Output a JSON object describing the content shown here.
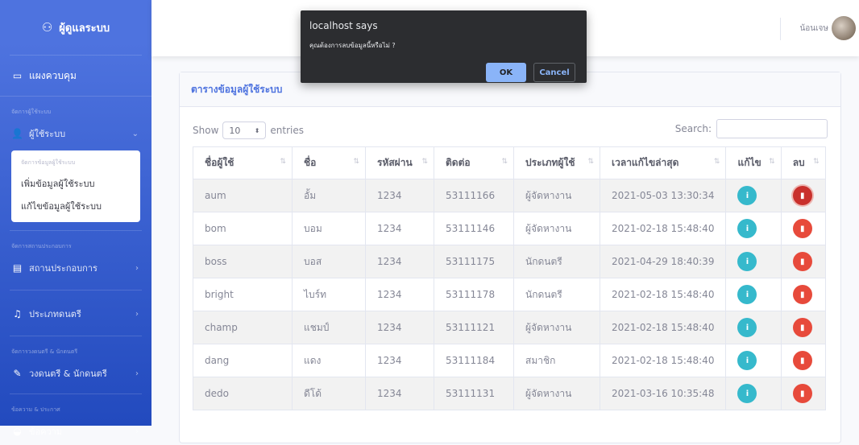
{
  "sidebar": {
    "brand": "ผู้ดูแลระบบ",
    "dashboard": "แผงควบคุม",
    "section_users": "จัดการผู้ใช้ระบบ",
    "users_item": "ผู้ใช้ระบบ",
    "submenu": {
      "header": "จัดการข้อมูลผู้ใช้ระบบ",
      "add": "เพิ่มข้อมูลผู้ใช้ระบบ",
      "edit": "แก้ไขข้อมูลผู้ใช้ระบบ"
    },
    "section_venues": "จัดการสถานประกอบการ",
    "venues_item": "สถานประกอบการ",
    "music_type_item": "ประเภทดนตรี",
    "section_bands": "จัดการวงดนตรี & นักดนตรี",
    "bands_item": "วงดนตรี & นักดนตรี",
    "section_messages": "ข้อความ & ประกาศ",
    "messages_item": "ข้อความ"
  },
  "topbar": {
    "username": "น้อนเจษ"
  },
  "card": {
    "title": "ตารางข้อมูลผู้ใช้ระบบ"
  },
  "controls": {
    "show_label": "Show",
    "entries_value": "10",
    "entries_label": "entries",
    "search_label": "Search:"
  },
  "table": {
    "headers": [
      "ชื่อผู้ใช้",
      "ชื่อ",
      "รหัสผ่าน",
      "ติดต่อ",
      "ประเภทผู้ใช้",
      "เวลาแก้ไขล่าสุด",
      "แก้ไข",
      "ลบ"
    ],
    "rows": [
      [
        "aum",
        "อั้ม",
        "1234",
        "53111166",
        "ผู้จัดหางาน",
        "2021-05-03 13:30:34"
      ],
      [
        "bom",
        "บอม",
        "1234",
        "53111146",
        "ผู้จัดหางาน",
        "2021-02-18 15:48:40"
      ],
      [
        "boss",
        "บอส",
        "1234",
        "53111175",
        "นักดนตรี",
        "2021-04-29 18:40:39"
      ],
      [
        "bright",
        "ไบร์ท",
        "1234",
        "53111178",
        "นักดนตรี",
        "2021-02-18 15:48:40"
      ],
      [
        "champ",
        "แชมป์",
        "1234",
        "53111121",
        "ผู้จัดหางาน",
        "2021-02-18 15:48:40"
      ],
      [
        "dang",
        "แดง",
        "1234",
        "53111184",
        "สมาชิก",
        "2021-02-18 15:48:40"
      ],
      [
        "dedo",
        "ดีโด้",
        "1234",
        "53111131",
        "ผู้จัดหางาน",
        "2021-03-16 10:35:48"
      ]
    ]
  },
  "dialog": {
    "title": "localhost says",
    "message": "คุณต้องการลบข้อมูลนี้หรือไม่ ?",
    "ok": "OK",
    "cancel": "Cancel"
  },
  "colors": {
    "primary": "#4e73df",
    "info": "#36b9cc",
    "danger": "#e74a3b"
  }
}
